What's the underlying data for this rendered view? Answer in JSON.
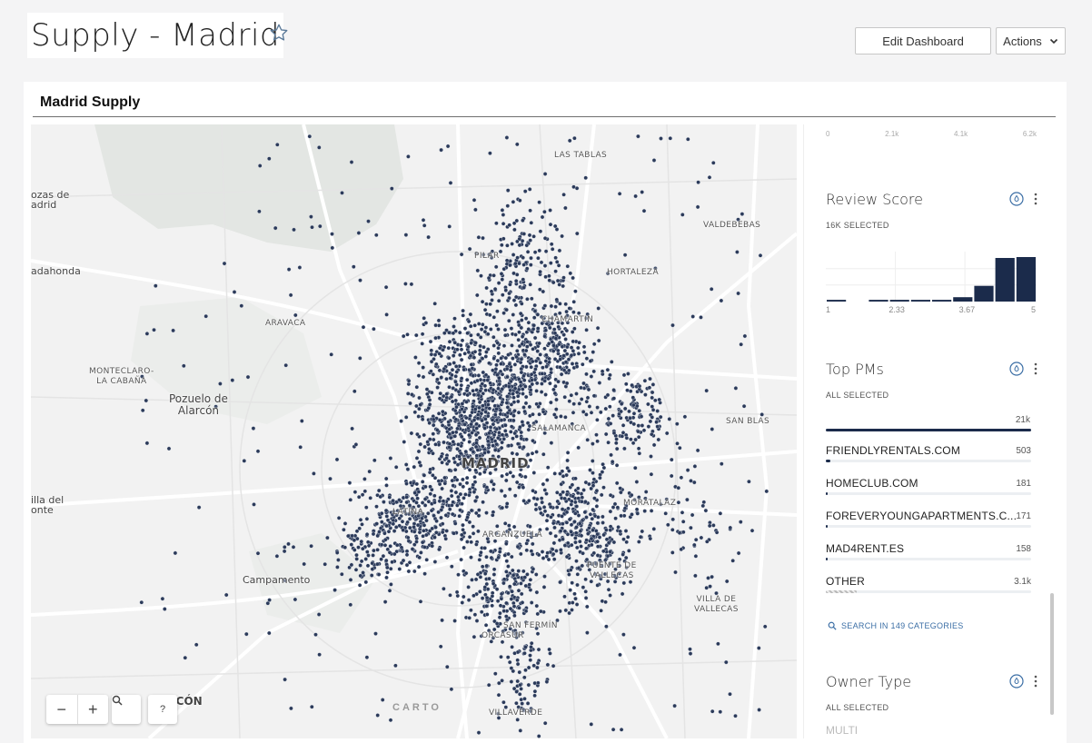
{
  "header": {
    "title": "Supply - Madrid",
    "edit_button": "Edit Dashboard",
    "actions_button": "Actions"
  },
  "panel": {
    "title": "Madrid Supply"
  },
  "map": {
    "labels": {
      "las_tablas": "LAS TABLAS",
      "rozas": "ozas de\nadrid",
      "valdebebas": "VALDEBEBAS",
      "pilar": "PILAR",
      "majadahonda": "adahonda",
      "hortaleza": "HORTALEZA",
      "aravaca": "ARAVACA",
      "chamartin": "CHAMARTIN",
      "montecarlo": "MONTECLARO-\nLA CABAÑA",
      "pozuelo": "Pozuelo de\nAlarcón",
      "salamanca": "SALAMANCA",
      "san_blas": "SAN BLAS",
      "madrid": "MADRID",
      "villa_del_monte": "illa del\nonte",
      "moratalaz": "MORATALAZ",
      "latina": "LATINA",
      "arganzuela": "ARGANZUELA",
      "campamento": "Campamento",
      "puente": "PUENTE DE\nVALLECAS",
      "villa_vallecas": "VILLA DE\nVALLECAS",
      "san_fermin": "SAN FERMÍN",
      "orcasur": "ORCASUR",
      "alcorcon": "LCÓN",
      "villaverde": "VILLAVERDE"
    },
    "attribution": "CARTO",
    "controls": {
      "zoom_out": "−",
      "zoom_in": "+",
      "search": "search",
      "help": "?"
    },
    "point_color": "#2b3a5a"
  },
  "sidebar": {
    "top_ticks": [
      "0",
      "2.1k",
      "4.1k",
      "6.2k"
    ],
    "review_score": {
      "title": "Review Score",
      "subtitle": "16K SELECTED",
      "chart_data": {
        "type": "bar",
        "x_ticks": [
          "1",
          "2.33",
          "3.67",
          "5"
        ],
        "values": [
          0.04,
          0.0,
          0.04,
          0.04,
          0.04,
          0.04,
          0.1,
          0.36,
          1.0,
          1.02
        ],
        "color": "#1b2b4b"
      }
    },
    "top_pms": {
      "title": "Top PMs",
      "subtitle": "ALL SELECTED",
      "total": "21k",
      "items": [
        {
          "name": "FRIENDLYRENTALS.COM",
          "value": "503",
          "fraction": 0.024
        },
        {
          "name": "HOMECLUB.COM",
          "value": "181",
          "fraction": 0.009
        },
        {
          "name": "FOREVERYOUNGAPARTMENTS.C...",
          "value": "171",
          "fraction": 0.008
        },
        {
          "name": "MAD4RENT.ES",
          "value": "158",
          "fraction": 0.008
        },
        {
          "name": "OTHER",
          "value": "3.1k",
          "fraction": 0.15
        }
      ],
      "search": "SEARCH IN 149 CATEGORIES"
    },
    "owner_type": {
      "title": "Owner Type",
      "subtitle": "ALL SELECTED",
      "first_item": "MULTI"
    }
  }
}
